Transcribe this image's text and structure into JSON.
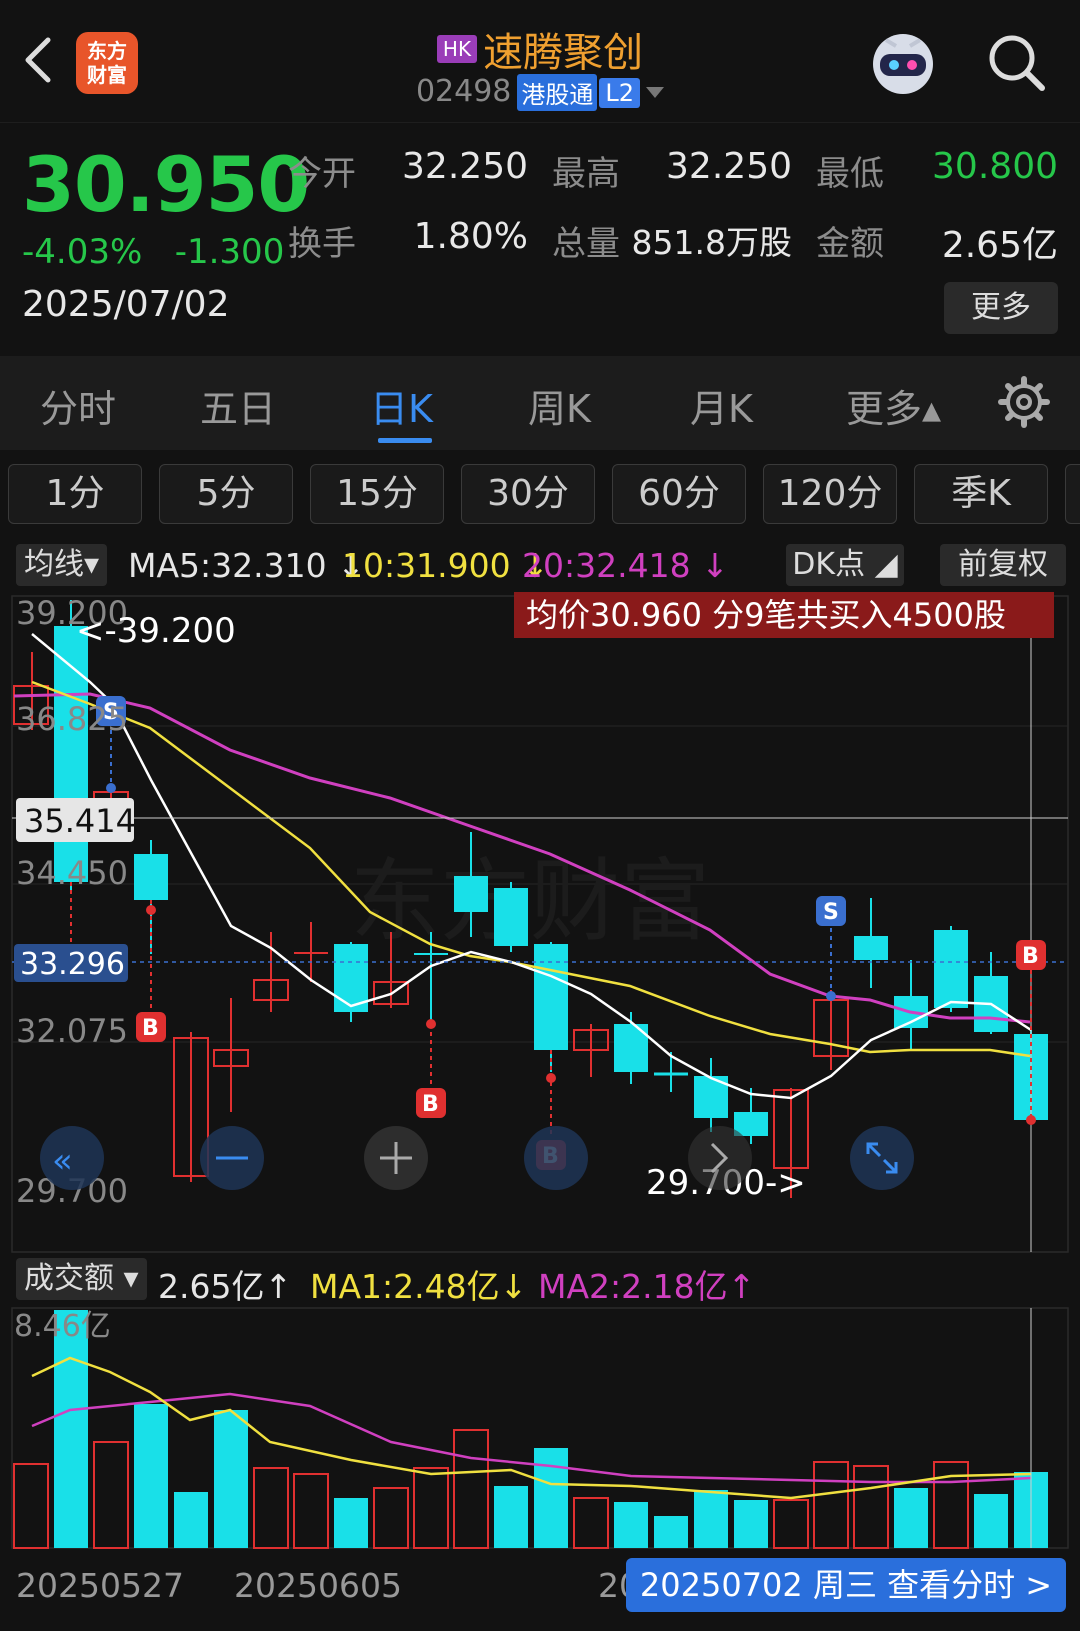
{
  "header": {
    "back_icon": "chevron-left-icon",
    "logo_line1": "东方",
    "logo_line2": "财富",
    "market_badge": "HK",
    "stock_name": "速腾聚创",
    "stock_code": "02498",
    "connect_tag": "港股通",
    "level_tag": "L2",
    "assistant_icon": "robot-icon",
    "search_icon": "search-icon"
  },
  "quote": {
    "price": "30.950",
    "change_pct": "-4.03%",
    "change_amt": "-1.300",
    "date": "2025/07/02",
    "open_label": "今开",
    "open": "32.250",
    "high_label": "最高",
    "high": "32.250",
    "low_label": "最低",
    "low": "30.800",
    "turnover_label": "换手",
    "turnover": "1.80%",
    "volume_label": "总量",
    "volume": "851.8万股",
    "amount_label": "金额",
    "amount": "2.65亿",
    "more_label": "更多"
  },
  "tabs": [
    "分时",
    "五日",
    "日K",
    "周K",
    "月K",
    "更多▴"
  ],
  "active_tab": "日K",
  "periods": [
    "1分",
    "5分",
    "15分",
    "30分",
    "60分",
    "120分",
    "季K"
  ],
  "indicator": {
    "mode_label": "均线▾",
    "ma5": "MA5:32.310 ↓",
    "ma10": "10:31.900 ↓",
    "ma20": "20:32.418 ↓",
    "dk_label": "DK点 ◢",
    "adjust_label": "前复权"
  },
  "kchart": {
    "y_labels": [
      "39.200",
      "36.825",
      "34.450",
      "32.075",
      "29.700"
    ],
    "crosshair_price": "35.414",
    "current_price_label": "33.296",
    "high_marker": "<-39.200",
    "low_marker": "29.700->",
    "trade_note": "均价30.960  分9笔共买入4500股",
    "colors": {
      "up": "#e03030",
      "down": "#19e0e8",
      "ma5": "#ffffff",
      "ma10": "#f0e040",
      "ma20": "#d040c0"
    }
  },
  "volume": {
    "label": "成交额 ▾",
    "value": "2.65亿↑",
    "ma1": "MA1:2.48亿↓",
    "ma2": "MA2:2.18亿↑",
    "y_label": "8.46亿"
  },
  "footer": {
    "x_labels": [
      "20250527",
      "20250605",
      "20"
    ],
    "pill": "20250702 周三 查看分时 >"
  }
}
